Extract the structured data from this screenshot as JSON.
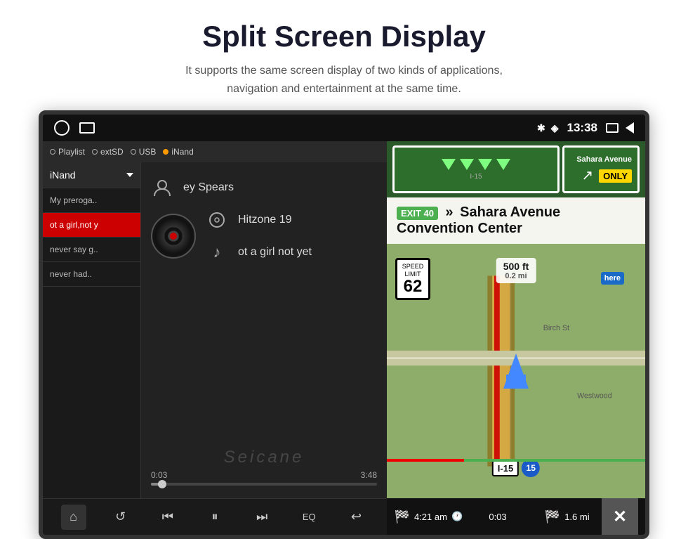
{
  "page": {
    "title": "Split Screen Display",
    "subtitle_line1": "It supports the same screen display of two kinds of applications,",
    "subtitle_line2": "navigation and entertainment at the same time."
  },
  "status_bar": {
    "time": "13:38",
    "bluetooth": "✱",
    "location": "◈"
  },
  "music": {
    "source_tabs": [
      {
        "label": "Playlist",
        "active": false
      },
      {
        "label": "extSD",
        "active": false
      },
      {
        "label": "USB",
        "active": false
      },
      {
        "label": "iNand",
        "active": true
      }
    ],
    "current_source": "iNand",
    "playlist": [
      {
        "title": "My preroga..",
        "active": false
      },
      {
        "title": "ot a girl,not y",
        "active": true
      },
      {
        "title": "never say g..",
        "active": false
      },
      {
        "title": "never had..",
        "active": false
      }
    ],
    "artist": "ey Spears",
    "album": "Hitzone 19",
    "track": "ot a girl not yet",
    "time_current": "0:03",
    "time_total": "3:48",
    "watermark": "Seicane",
    "controls": {
      "home": "⌂",
      "repeat": "↺",
      "prev": "⏮",
      "pause": "⏸",
      "next": "⏭",
      "eq": "EQ",
      "back": "↩"
    }
  },
  "navigation": {
    "exit_number": "EXIT 40",
    "street": "Sahara Avenue",
    "location": "Convention Center",
    "distance_ft": "500 ft",
    "distance_mi": "0.2 mi",
    "speed": "62",
    "highway": "I-15",
    "highway_num": "15",
    "only_label": "ONLY",
    "sahara_label": "Sahara Avenue",
    "bottom": {
      "eta": "4:21 am",
      "elapsed": "0:03",
      "remaining_mi": "1.6 mi"
    }
  }
}
